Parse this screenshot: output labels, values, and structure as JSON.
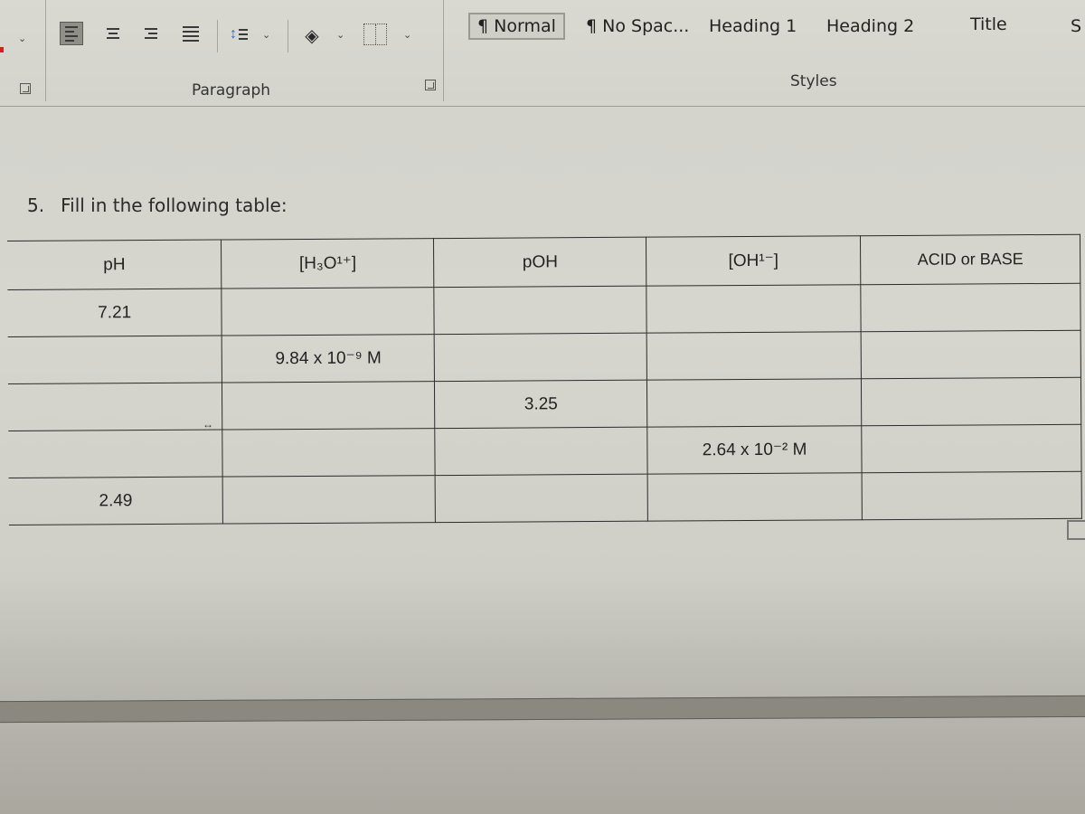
{
  "ribbon": {
    "paragraph_group_label": "Paragraph",
    "styles_group_label": "Styles",
    "paragraph_buttons": [
      {
        "icon": "align-left-icon",
        "active": true
      },
      {
        "icon": "align-center-icon",
        "active": false
      },
      {
        "icon": "align-right-icon",
        "active": false
      },
      {
        "icon": "justify-icon",
        "active": false
      },
      {
        "icon": "line-spacing-icon",
        "active": false
      },
      {
        "icon": "shading-icon",
        "active": false
      },
      {
        "icon": "borders-icon",
        "active": false
      }
    ],
    "styles": [
      {
        "label": "¶ Normal",
        "selected": true
      },
      {
        "label": "¶ No Spac...",
        "selected": false
      },
      {
        "label": "Heading 1",
        "selected": false
      },
      {
        "label": "Heading 2",
        "selected": false
      },
      {
        "label": "Title",
        "selected": false
      },
      {
        "label": "S",
        "selected": false
      }
    ]
  },
  "document": {
    "question_number": "5.",
    "question_text": "Fill in the following table:",
    "table": {
      "headers": [
        "pH",
        "[H₃O¹⁺]",
        "pOH",
        "[OH¹⁻]",
        "ACID or BASE"
      ],
      "rows": [
        [
          "7.21",
          "",
          "",
          "",
          ""
        ],
        [
          "",
          "9.84 x 10⁻⁹ M",
          "",
          "",
          ""
        ],
        [
          "",
          "",
          "3.25",
          "",
          ""
        ],
        [
          "",
          "",
          "",
          "2.64 x 10⁻² M",
          ""
        ],
        [
          "2.49",
          "",
          "",
          "",
          ""
        ]
      ]
    }
  }
}
